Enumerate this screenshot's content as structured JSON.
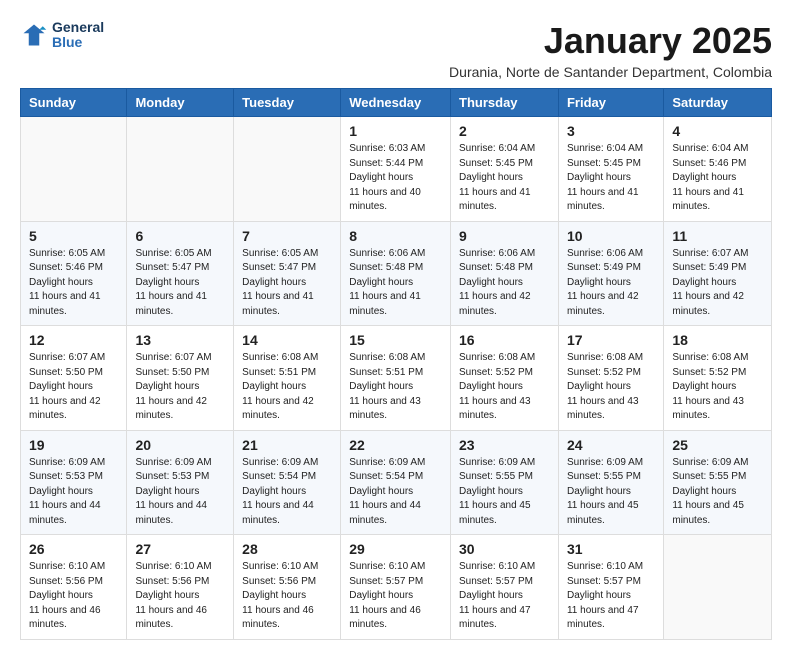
{
  "logo": {
    "general": "General",
    "blue": "Blue"
  },
  "title": "January 2025",
  "subtitle": "Durania, Norte de Santander Department, Colombia",
  "days": [
    "Sunday",
    "Monday",
    "Tuesday",
    "Wednesday",
    "Thursday",
    "Friday",
    "Saturday"
  ],
  "weeks": [
    [
      {
        "day": "",
        "sunrise": "",
        "sunset": "",
        "daylight": ""
      },
      {
        "day": "",
        "sunrise": "",
        "sunset": "",
        "daylight": ""
      },
      {
        "day": "",
        "sunrise": "",
        "sunset": "",
        "daylight": ""
      },
      {
        "day": "1",
        "sunrise": "6:03 AM",
        "sunset": "5:44 PM",
        "daylight": "11 hours and 40 minutes."
      },
      {
        "day": "2",
        "sunrise": "6:04 AM",
        "sunset": "5:45 PM",
        "daylight": "11 hours and 41 minutes."
      },
      {
        "day": "3",
        "sunrise": "6:04 AM",
        "sunset": "5:45 PM",
        "daylight": "11 hours and 41 minutes."
      },
      {
        "day": "4",
        "sunrise": "6:04 AM",
        "sunset": "5:46 PM",
        "daylight": "11 hours and 41 minutes."
      }
    ],
    [
      {
        "day": "5",
        "sunrise": "6:05 AM",
        "sunset": "5:46 PM",
        "daylight": "11 hours and 41 minutes."
      },
      {
        "day": "6",
        "sunrise": "6:05 AM",
        "sunset": "5:47 PM",
        "daylight": "11 hours and 41 minutes."
      },
      {
        "day": "7",
        "sunrise": "6:05 AM",
        "sunset": "5:47 PM",
        "daylight": "11 hours and 41 minutes."
      },
      {
        "day": "8",
        "sunrise": "6:06 AM",
        "sunset": "5:48 PM",
        "daylight": "11 hours and 41 minutes."
      },
      {
        "day": "9",
        "sunrise": "6:06 AM",
        "sunset": "5:48 PM",
        "daylight": "11 hours and 42 minutes."
      },
      {
        "day": "10",
        "sunrise": "6:06 AM",
        "sunset": "5:49 PM",
        "daylight": "11 hours and 42 minutes."
      },
      {
        "day": "11",
        "sunrise": "6:07 AM",
        "sunset": "5:49 PM",
        "daylight": "11 hours and 42 minutes."
      }
    ],
    [
      {
        "day": "12",
        "sunrise": "6:07 AM",
        "sunset": "5:50 PM",
        "daylight": "11 hours and 42 minutes."
      },
      {
        "day": "13",
        "sunrise": "6:07 AM",
        "sunset": "5:50 PM",
        "daylight": "11 hours and 42 minutes."
      },
      {
        "day": "14",
        "sunrise": "6:08 AM",
        "sunset": "5:51 PM",
        "daylight": "11 hours and 42 minutes."
      },
      {
        "day": "15",
        "sunrise": "6:08 AM",
        "sunset": "5:51 PM",
        "daylight": "11 hours and 43 minutes."
      },
      {
        "day": "16",
        "sunrise": "6:08 AM",
        "sunset": "5:52 PM",
        "daylight": "11 hours and 43 minutes."
      },
      {
        "day": "17",
        "sunrise": "6:08 AM",
        "sunset": "5:52 PM",
        "daylight": "11 hours and 43 minutes."
      },
      {
        "day": "18",
        "sunrise": "6:08 AM",
        "sunset": "5:52 PM",
        "daylight": "11 hours and 43 minutes."
      }
    ],
    [
      {
        "day": "19",
        "sunrise": "6:09 AM",
        "sunset": "5:53 PM",
        "daylight": "11 hours and 44 minutes."
      },
      {
        "day": "20",
        "sunrise": "6:09 AM",
        "sunset": "5:53 PM",
        "daylight": "11 hours and 44 minutes."
      },
      {
        "day": "21",
        "sunrise": "6:09 AM",
        "sunset": "5:54 PM",
        "daylight": "11 hours and 44 minutes."
      },
      {
        "day": "22",
        "sunrise": "6:09 AM",
        "sunset": "5:54 PM",
        "daylight": "11 hours and 44 minutes."
      },
      {
        "day": "23",
        "sunrise": "6:09 AM",
        "sunset": "5:55 PM",
        "daylight": "11 hours and 45 minutes."
      },
      {
        "day": "24",
        "sunrise": "6:09 AM",
        "sunset": "5:55 PM",
        "daylight": "11 hours and 45 minutes."
      },
      {
        "day": "25",
        "sunrise": "6:09 AM",
        "sunset": "5:55 PM",
        "daylight": "11 hours and 45 minutes."
      }
    ],
    [
      {
        "day": "26",
        "sunrise": "6:10 AM",
        "sunset": "5:56 PM",
        "daylight": "11 hours and 46 minutes."
      },
      {
        "day": "27",
        "sunrise": "6:10 AM",
        "sunset": "5:56 PM",
        "daylight": "11 hours and 46 minutes."
      },
      {
        "day": "28",
        "sunrise": "6:10 AM",
        "sunset": "5:56 PM",
        "daylight": "11 hours and 46 minutes."
      },
      {
        "day": "29",
        "sunrise": "6:10 AM",
        "sunset": "5:57 PM",
        "daylight": "11 hours and 46 minutes."
      },
      {
        "day": "30",
        "sunrise": "6:10 AM",
        "sunset": "5:57 PM",
        "daylight": "11 hours and 47 minutes."
      },
      {
        "day": "31",
        "sunrise": "6:10 AM",
        "sunset": "5:57 PM",
        "daylight": "11 hours and 47 minutes."
      },
      {
        "day": "",
        "sunrise": "",
        "sunset": "",
        "daylight": ""
      }
    ]
  ]
}
